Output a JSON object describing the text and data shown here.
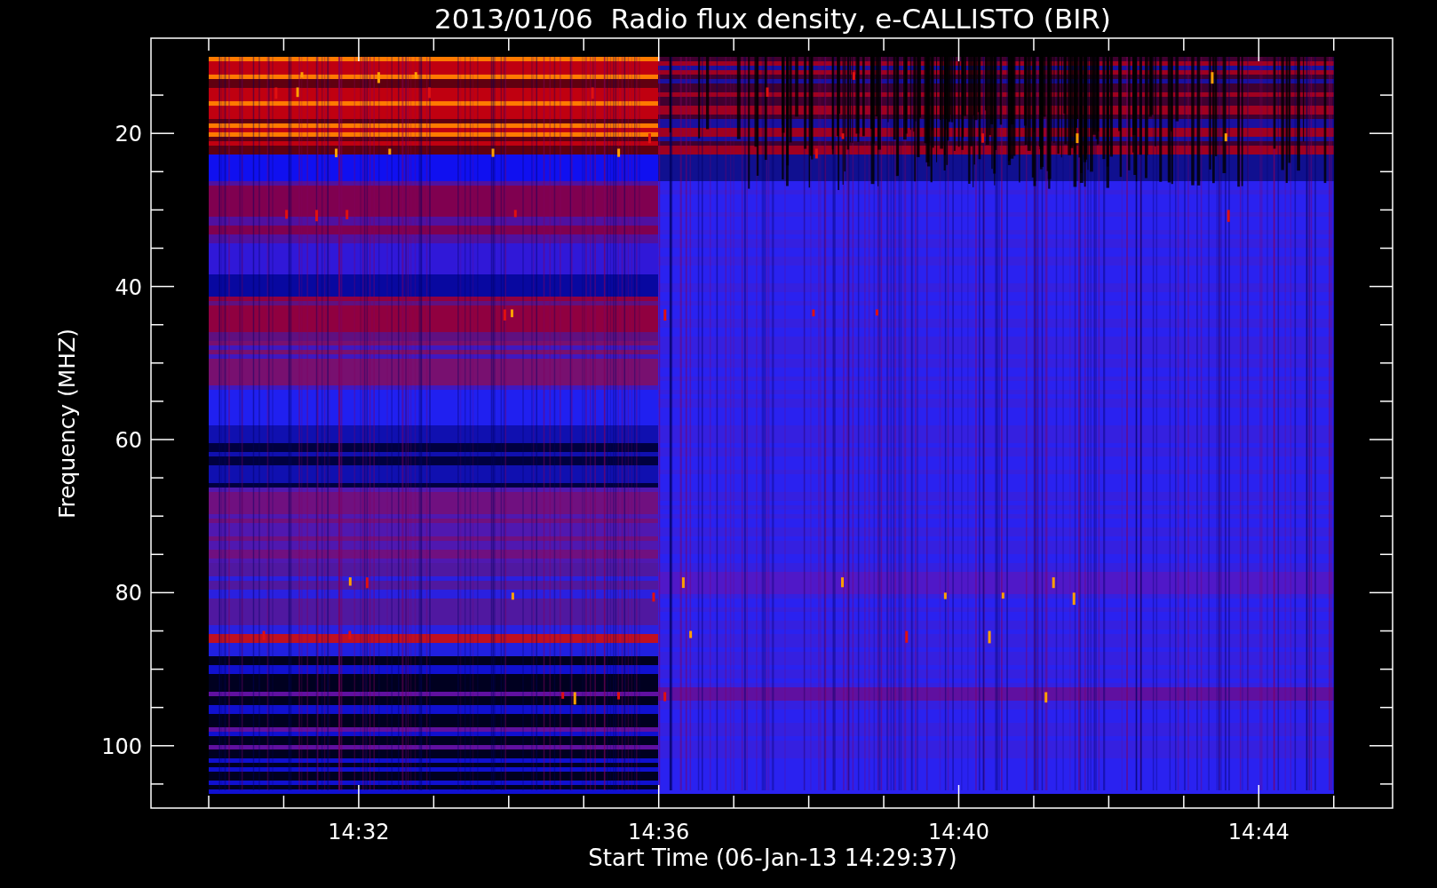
{
  "title": "2013/01/06  Radio flux density, e-CALLISTO (BIR)",
  "ylabel": "Frequency (MHZ)",
  "xlabel": "Start Time (06-Jan-13 14:29:37)",
  "yticks": [
    "20",
    "40",
    "60",
    "80",
    "100"
  ],
  "xticks": [
    "14:32",
    "14:36",
    "14:40",
    "14:44"
  ]
}
